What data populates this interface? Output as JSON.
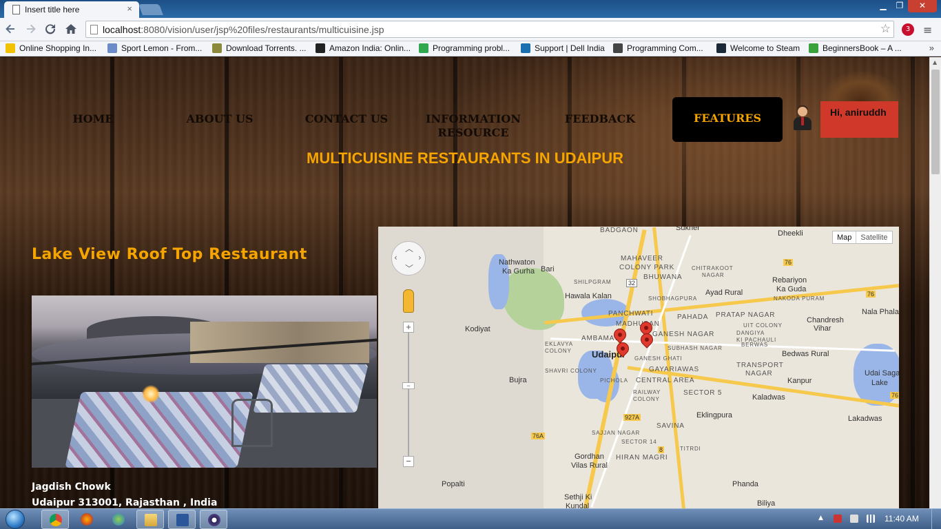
{
  "browser": {
    "tab_title": "Insert title here",
    "tab_close": "×",
    "url_host": "localhost",
    "url_rest": ":8080/vision/user/jsp%20files/restaurants/multicuisine.jsp",
    "window_controls": {
      "minimize": "▁",
      "maximize": "❐",
      "close": "✕"
    },
    "nav_icons": {
      "back": "arrow-left-icon",
      "forward": "arrow-right-icon",
      "reload": "reload-icon",
      "home": "home-icon"
    },
    "bookmarks": [
      {
        "label": "Online Shopping In...",
        "color": "#f2c200"
      },
      {
        "label": "Sport Lemon - From...",
        "color": "#6b8cc9"
      },
      {
        "label": "Download Torrents. ...",
        "color": "#8a8a3a"
      },
      {
        "label": "Amazon India: Onlin...",
        "color": "#222222"
      },
      {
        "label": "Programming probl...",
        "color": "#2fa84f"
      },
      {
        "label": "Support | Dell India",
        "color": "#1a6fb0"
      },
      {
        "label": "Programming Com...",
        "color": "#444444"
      },
      {
        "label": "Welcome to Steam",
        "color": "#1b2838"
      },
      {
        "label": "BeginnersBook – A ...",
        "color": "#3aa23a"
      }
    ],
    "bookmarks_more": "»",
    "menu_glyph": "≡",
    "star_glyph": "☆",
    "ext_badge": "3"
  },
  "page": {
    "nav": [
      {
        "label": "HOME"
      },
      {
        "label": "ABOUT US"
      },
      {
        "label": "CONTACT US"
      },
      {
        "label": "INFORMATION RESOURCE"
      },
      {
        "label": "FEEDBACK"
      }
    ],
    "features_label": "FEATURES",
    "greeting": "Hi, aniruddh",
    "heading": "MULTICUISINE RESTAURANTS IN UDAIPUR",
    "restaurant": {
      "name": "Lake View Roof Top Restaurant",
      "address_line1": "Jagdish Chowk",
      "address_line2": "Udaipur 313001, Rajasthan , India"
    },
    "accent_color": "#f5a400"
  },
  "map": {
    "type_map": "Map",
    "type_satellite": "Satellite",
    "zoom_in": "+",
    "zoom_out": "−",
    "zoom_mid": "−",
    "labels": {
      "sukher": "Sukher",
      "dheekli": "Dheekli",
      "badgaon": "BADGAON",
      "nathwaton": "Nathwaton",
      "kagurha": "Ka Gurha",
      "bari": "Bari",
      "mahaveer": "MAHAVEER",
      "colonypark": "COLONY PARK",
      "bhuwana": "BHUWANA",
      "chitrakoot": "CHITRAKOOT",
      "nagar": "NAGAR",
      "rebariyon": "Rebariyon",
      "kaguda": "Ka Guda",
      "nakoda": "NAKODA PURAM",
      "shilpgram": "SHILPGRAM",
      "hawala": "Hawala Kalan",
      "shobhagpura": "SHOBHAGPURA",
      "ayad": "Ayad Rural",
      "panchwati": "PANCHWATI",
      "madhuban": "MADHUBAN",
      "pahada": "PAHADA",
      "pratap": "PRATAP NAGAR",
      "utcolony": "UIT COLONY",
      "chandresh": "Chandresh",
      "vihar": "Vihar",
      "nalaphala": "Nala Phala",
      "kodiyat": "Kodiyat",
      "ambamata": "AMBAMATA",
      "eklavya": "EKLAVYA",
      "colony": "COLONY",
      "ganeshnagar": "GANESH NAGAR",
      "dangiya": "DANGIYA",
      "kipachauli": "KI PACHAULI",
      "berwas": "BERWAS",
      "udaipur": "Udaipur",
      "subhash": "SUBHASH NAGAR",
      "ganeshghati": "GANESH GHATI",
      "bedwas": "Bedwas Rural",
      "shavri": "SHAVRI COLONY",
      "gayariawas": "GAYARIAWAS",
      "transport": "TRANSPORT",
      "tnagar": "NAGAR",
      "bujra": "Bujra",
      "pichola": "PICHOLA",
      "central": "CENTRAL AREA",
      "kanpur": "Kanpur",
      "udaisagar": "Udai Sagar",
      "lake": "Lake",
      "railway": "RAILWAY",
      "rcolony": "COLONY",
      "sector5": "SECTOR 5",
      "kaladwas": "Kaladwas",
      "eklingpura": "Eklingpura",
      "lakadwas": "Lakadwas",
      "savina": "SAVINA",
      "sajjan": "SAJJAN NAGAR",
      "sector14": "SECTOR 14",
      "titrdi": "TITRDI",
      "gordhan": "Gordhan",
      "vilasrural": "Vilas Rural",
      "hiran": "HIRAN MAGRI",
      "popalti": "Popalti",
      "phanda": "Phanda",
      "sethji": "Sethji Ki",
      "kundal": "Kundal",
      "biliya": "Biliya",
      "r32": "32",
      "r76a": "76",
      "r76b": "76",
      "r927a": "927A",
      "r76a2": "76A",
      "r8": "8",
      "r76c": "76"
    }
  },
  "taskbar": {
    "clock": "11:40 AM",
    "tray_arrow": "▲"
  }
}
